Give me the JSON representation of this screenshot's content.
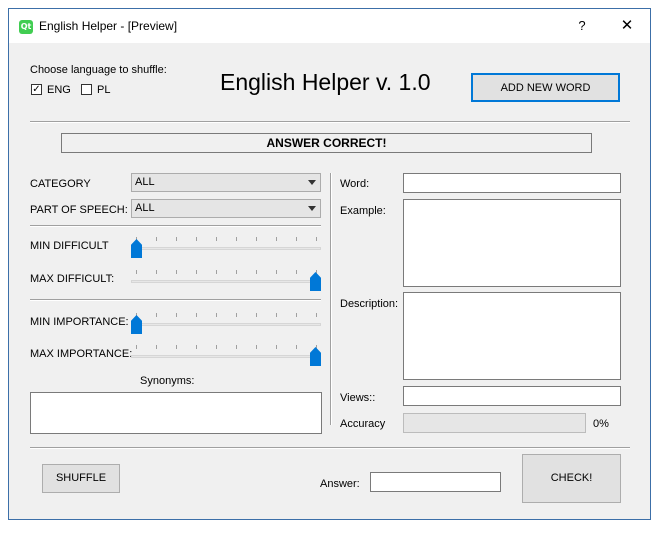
{
  "window": {
    "title": "English Helper - [Preview]",
    "help_label": "?",
    "close_label": "✕"
  },
  "language": {
    "prompt": "Choose language to shuffle:",
    "eng_label": "ENG",
    "eng_checked": true,
    "pl_label": "PL",
    "pl_checked": false
  },
  "app_title": "English Helper v. 1.0",
  "add_word_label": "ADD NEW WORD",
  "status_text": "ANSWER CORRECT!",
  "filters": {
    "category_label": "CATEGORY",
    "category_value": "ALL",
    "pos_label": "PART OF SPEECH:",
    "pos_value": "ALL"
  },
  "sliders": {
    "min_difficult_label": "MIN DIFFICULT",
    "min_difficult_value": 0,
    "max_difficult_label": "MAX DIFFICULT:",
    "max_difficult_value": 1,
    "min_importance_label": "MIN IMPORTANCE:",
    "min_importance_value": 0,
    "max_importance_label": "MAX IMPORTANCE:",
    "max_importance_value": 1
  },
  "synonyms_label": "Synonyms:",
  "details": {
    "word_label": "Word:",
    "word_value": "",
    "example_label": "Example:",
    "description_label": "Description:",
    "views_label": "Views::",
    "views_value": "",
    "accuracy_label": "Accuracy",
    "accuracy_value": "0%",
    "accuracy_fraction": 0
  },
  "shuffle_label": "SHUFFLE",
  "answer_label": "Answer:",
  "answer_value": "",
  "check_label": "CHECK!",
  "colors": {
    "accent": "#0078d7",
    "window_bg": "#f0f0f0",
    "qt_icon": "#41cd52"
  },
  "icons": {
    "app": "qt-logo-icon"
  }
}
